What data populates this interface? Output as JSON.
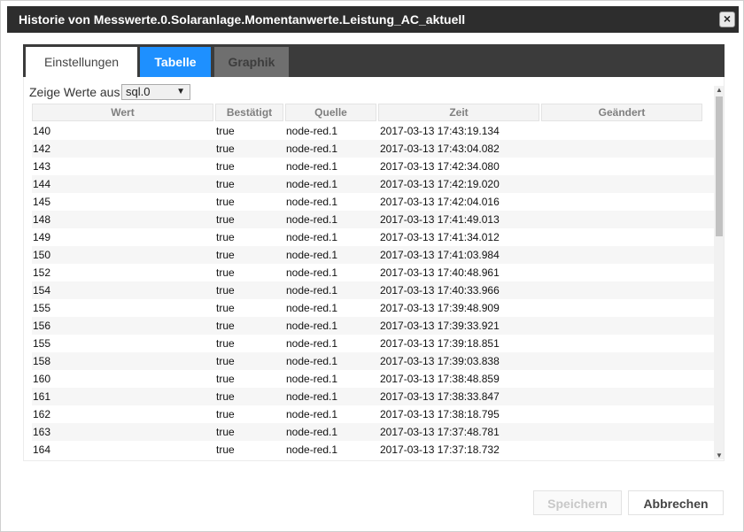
{
  "dialog": {
    "title": "Historie von Messwerte.0.Solaranlage.Momentanwerte.Leistung_AC_aktuell",
    "close_symbol": "×"
  },
  "tabs": [
    {
      "label": "Einstellungen"
    },
    {
      "label": "Tabelle"
    },
    {
      "label": "Graphik"
    }
  ],
  "source": {
    "label": "Zeige Werte aus",
    "value": "sql.0"
  },
  "table": {
    "columns": [
      "Wert",
      "Bestätigt",
      "Quelle",
      "Zeit",
      "Geändert"
    ],
    "rows": [
      {
        "wert": "140",
        "best": "true",
        "quelle": "node-red.1",
        "zeit": "2017-03-13 17:43:19.134"
      },
      {
        "wert": "142",
        "best": "true",
        "quelle": "node-red.1",
        "zeit": "2017-03-13 17:43:04.082"
      },
      {
        "wert": "143",
        "best": "true",
        "quelle": "node-red.1",
        "zeit": "2017-03-13 17:42:34.080"
      },
      {
        "wert": "144",
        "best": "true",
        "quelle": "node-red.1",
        "zeit": "2017-03-13 17:42:19.020"
      },
      {
        "wert": "145",
        "best": "true",
        "quelle": "node-red.1",
        "zeit": "2017-03-13 17:42:04.016"
      },
      {
        "wert": "148",
        "best": "true",
        "quelle": "node-red.1",
        "zeit": "2017-03-13 17:41:49.013"
      },
      {
        "wert": "149",
        "best": "true",
        "quelle": "node-red.1",
        "zeit": "2017-03-13 17:41:34.012"
      },
      {
        "wert": "150",
        "best": "true",
        "quelle": "node-red.1",
        "zeit": "2017-03-13 17:41:03.984"
      },
      {
        "wert": "152",
        "best": "true",
        "quelle": "node-red.1",
        "zeit": "2017-03-13 17:40:48.961"
      },
      {
        "wert": "154",
        "best": "true",
        "quelle": "node-red.1",
        "zeit": "2017-03-13 17:40:33.966"
      },
      {
        "wert": "155",
        "best": "true",
        "quelle": "node-red.1",
        "zeit": "2017-03-13 17:39:48.909"
      },
      {
        "wert": "156",
        "best": "true",
        "quelle": "node-red.1",
        "zeit": "2017-03-13 17:39:33.921"
      },
      {
        "wert": "155",
        "best": "true",
        "quelle": "node-red.1",
        "zeit": "2017-03-13 17:39:18.851"
      },
      {
        "wert": "158",
        "best": "true",
        "quelle": "node-red.1",
        "zeit": "2017-03-13 17:39:03.838"
      },
      {
        "wert": "160",
        "best": "true",
        "quelle": "node-red.1",
        "zeit": "2017-03-13 17:38:48.859"
      },
      {
        "wert": "161",
        "best": "true",
        "quelle": "node-red.1",
        "zeit": "2017-03-13 17:38:33.847"
      },
      {
        "wert": "162",
        "best": "true",
        "quelle": "node-red.1",
        "zeit": "2017-03-13 17:38:18.795"
      },
      {
        "wert": "163",
        "best": "true",
        "quelle": "node-red.1",
        "zeit": "2017-03-13 17:37:48.781"
      },
      {
        "wert": "164",
        "best": "true",
        "quelle": "node-red.1",
        "zeit": "2017-03-13 17:37:18.732"
      }
    ]
  },
  "buttons": {
    "save_label": "Speichern",
    "cancel_label": "Abbrechen"
  },
  "colors": {
    "title_bar": "#2d2d2d",
    "active_tab": "#1e90ff",
    "tab_bar": "#3b3b3b"
  }
}
